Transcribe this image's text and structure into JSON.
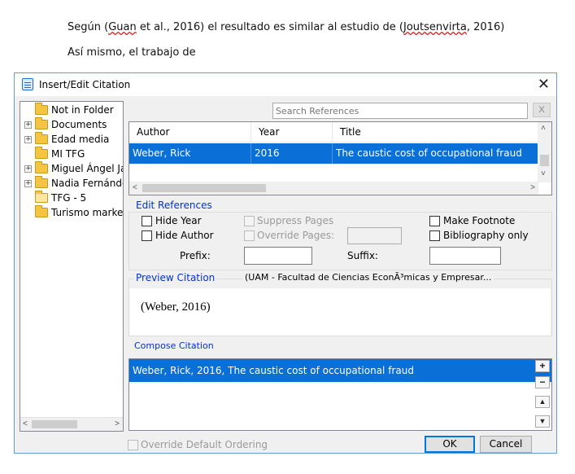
{
  "document": {
    "line1_prefix": "Según (",
    "line1_author1": "Guan",
    "line1_mid": " et al., 2016) el resultado es similar al estudio de (",
    "line1_author2": "Joutsenvirta",
    "line1_suffix": ", 2016)",
    "line2": "Así mismo, el trabajo de"
  },
  "dialog": {
    "title": "Insert/Edit Citation",
    "close_glyph": "✕",
    "folders": [
      {
        "label": "Not in Folder",
        "expandable": false,
        "open": false
      },
      {
        "label": "Documents",
        "expandable": true,
        "open": false
      },
      {
        "label": "Edad media",
        "expandable": true,
        "open": false
      },
      {
        "label": "MI TFG",
        "expandable": false,
        "open": false
      },
      {
        "label": "Miguel Ángel Ja",
        "expandable": true,
        "open": false
      },
      {
        "label": "Nadia Fernánde",
        "expandable": true,
        "open": false
      },
      {
        "label": "TFG - 5",
        "expandable": false,
        "open": true
      },
      {
        "label": "Turismo market",
        "expandable": false,
        "open": false
      }
    ],
    "search": {
      "placeholder": "Search References",
      "value": "",
      "clear_label": "X"
    },
    "table": {
      "columns": [
        "Author",
        "Year",
        "Title"
      ],
      "rows": [
        {
          "author": "Weber, Rick",
          "year": "2016",
          "title": "The caustic cost of occupational fraud"
        }
      ]
    },
    "edit_refs": {
      "label": "Edit References",
      "hide_year": "Hide Year",
      "hide_author": "Hide Author",
      "suppress_pages": "Suppress Pages",
      "override_pages": "Override Pages:",
      "make_footnote": "Make Footnote",
      "bibliography_only": "Bibliography only",
      "prefix_label": "Prefix:",
      "suffix_label": "Suffix:",
      "prefix_value": "",
      "suffix_value": ""
    },
    "preview": {
      "label": "Preview Citation",
      "style": "(UAM - Facultad de Ciencias EconÃ³micas y Empresar...",
      "citation": "(Weber, 2016)"
    },
    "compose": {
      "label": "Compose Citation",
      "items": [
        "Weber, Rick, 2016, The caustic cost of occupational fraud"
      ]
    },
    "side_buttons": {
      "add": "+",
      "remove": "−",
      "up": "▲",
      "down": "▼"
    },
    "override_ordering": "Override Default Ordering",
    "ok_label": "OK",
    "cancel_label": "Cancel"
  }
}
